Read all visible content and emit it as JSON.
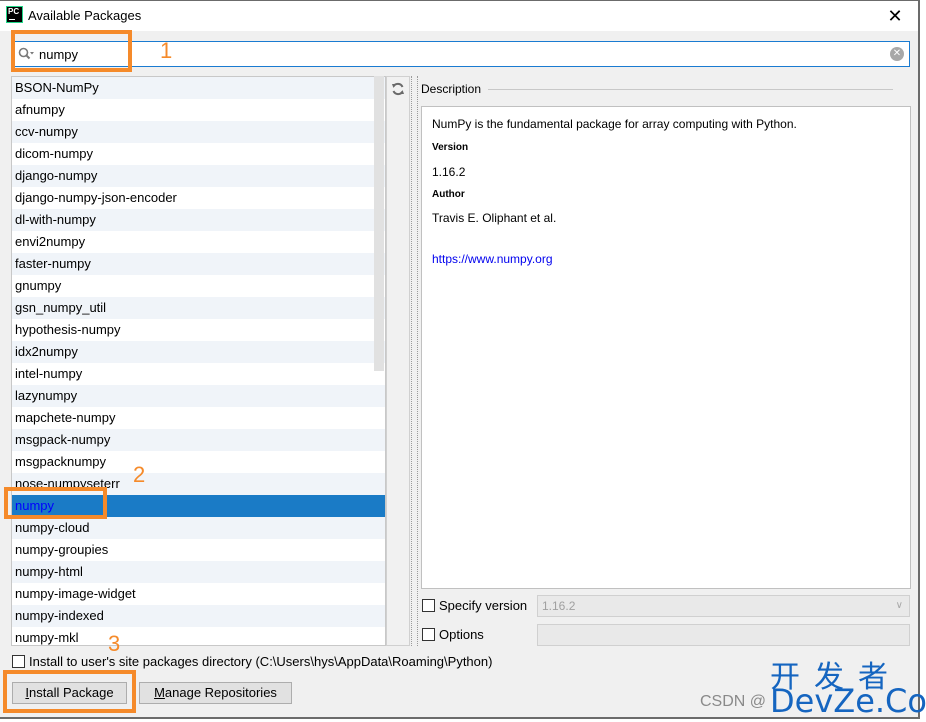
{
  "window": {
    "app_icon_text": "PC",
    "title": "Available Packages",
    "close_glyph": "✕"
  },
  "search": {
    "icon": "search-icon",
    "value": "numpy",
    "clear_glyph": "✕"
  },
  "packages": [
    "BSON-NumPy",
    "afnumpy",
    "ccv-numpy",
    "dicom-numpy",
    "django-numpy",
    "django-numpy-json-encoder",
    "dl-with-numpy",
    "envi2numpy",
    "faster-numpy",
    "gnumpy",
    "gsn_numpy_util",
    "hypothesis-numpy",
    "idx2numpy",
    "intel-numpy",
    "lazynumpy",
    "mapchete-numpy",
    "msgpack-numpy",
    "msgpacknumpy",
    "nose-numpyseterr",
    "numpy",
    "numpy-cloud",
    "numpy-groupies",
    "numpy-html",
    "numpy-image-widget",
    "numpy-indexed",
    "numpy-mkl"
  ],
  "selected_package": "numpy",
  "refresh_icon": "⟳",
  "description": {
    "section_label": "Description",
    "summary": "NumPy is the fundamental package for array computing with Python.",
    "version_label": "Version",
    "version": "1.16.2",
    "author_label": "Author",
    "author": "Travis E. Oliphant et al.",
    "url": "https://www.numpy.org"
  },
  "options": {
    "specify_version_label": "Specify version",
    "specify_version_checked": false,
    "version_value": "1.16.2",
    "options_label": "Options",
    "options_checked": false,
    "options_value": ""
  },
  "install_user_site": {
    "label": "Install to user's site packages directory (C:\\Users\\hys\\AppData\\Roaming\\Python)",
    "checked": false
  },
  "buttons": {
    "install_mnemonic": "I",
    "install_rest": "nstall Package",
    "manage_mnemonic": "M",
    "manage_rest": "anage Repositories"
  },
  "annotations": {
    "step1": "1",
    "step2": "2",
    "step3": "3",
    "color": "#f58a2a"
  },
  "watermark": {
    "cn": "开发者",
    "csdn": "CSDN @",
    "devze": "DevZe.CoM"
  }
}
